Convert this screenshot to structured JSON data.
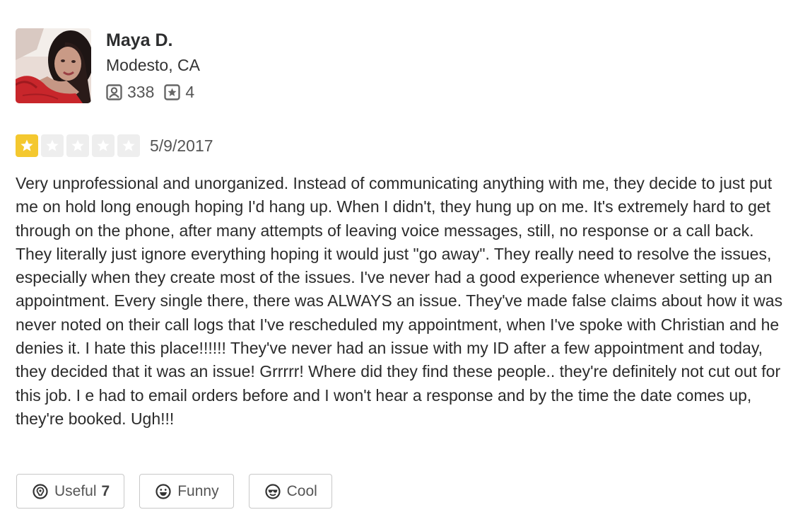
{
  "user": {
    "name": "Maya D.",
    "location": "Modesto, CA",
    "friends_count": "338",
    "reviews_count": "4"
  },
  "review": {
    "rating": 1,
    "max_rating": 5,
    "date": "5/9/2017",
    "text": "Very unprofessional and unorganized. Instead of communicating anything with me, they decide to just put me on hold long enough hoping I'd hang up. When I didn't, they hung up on me. It's extremely hard to get through on the phone, after many attempts of leaving voice messages, still, no response or a call back. They literally just ignore everything hoping it would just \"go away\". They really need to resolve the issues, especially when they create most of the issues. I've never had a good experience whenever setting up an appointment. Every single there, there was ALWAYS an issue. They've made false claims about how it was never noted on their call logs that I've rescheduled my appointment, when I've spoke with Christian and he denies it. I hate this place!!!!!! They've never had an issue with my ID after a few appointment and today, they decided that it was an issue! Grrrrr! Where did they find these people.. they're definitely not cut out for this job. I e had to email orders before and I won't hear a response and by the time the date comes up, they're booked. Ugh!!!"
  },
  "reactions": {
    "useful_label": "Useful",
    "useful_count": "7",
    "funny_label": "Funny",
    "cool_label": "Cool"
  },
  "icons": {
    "friends": "friends-icon",
    "reviews": "review-star-icon",
    "useful": "lightbulb-pin-icon",
    "funny": "smiley-icon",
    "cool": "sunglasses-icon"
  },
  "colors": {
    "star_filled": "#f4c82f",
    "star_empty": "#eeeeee"
  }
}
